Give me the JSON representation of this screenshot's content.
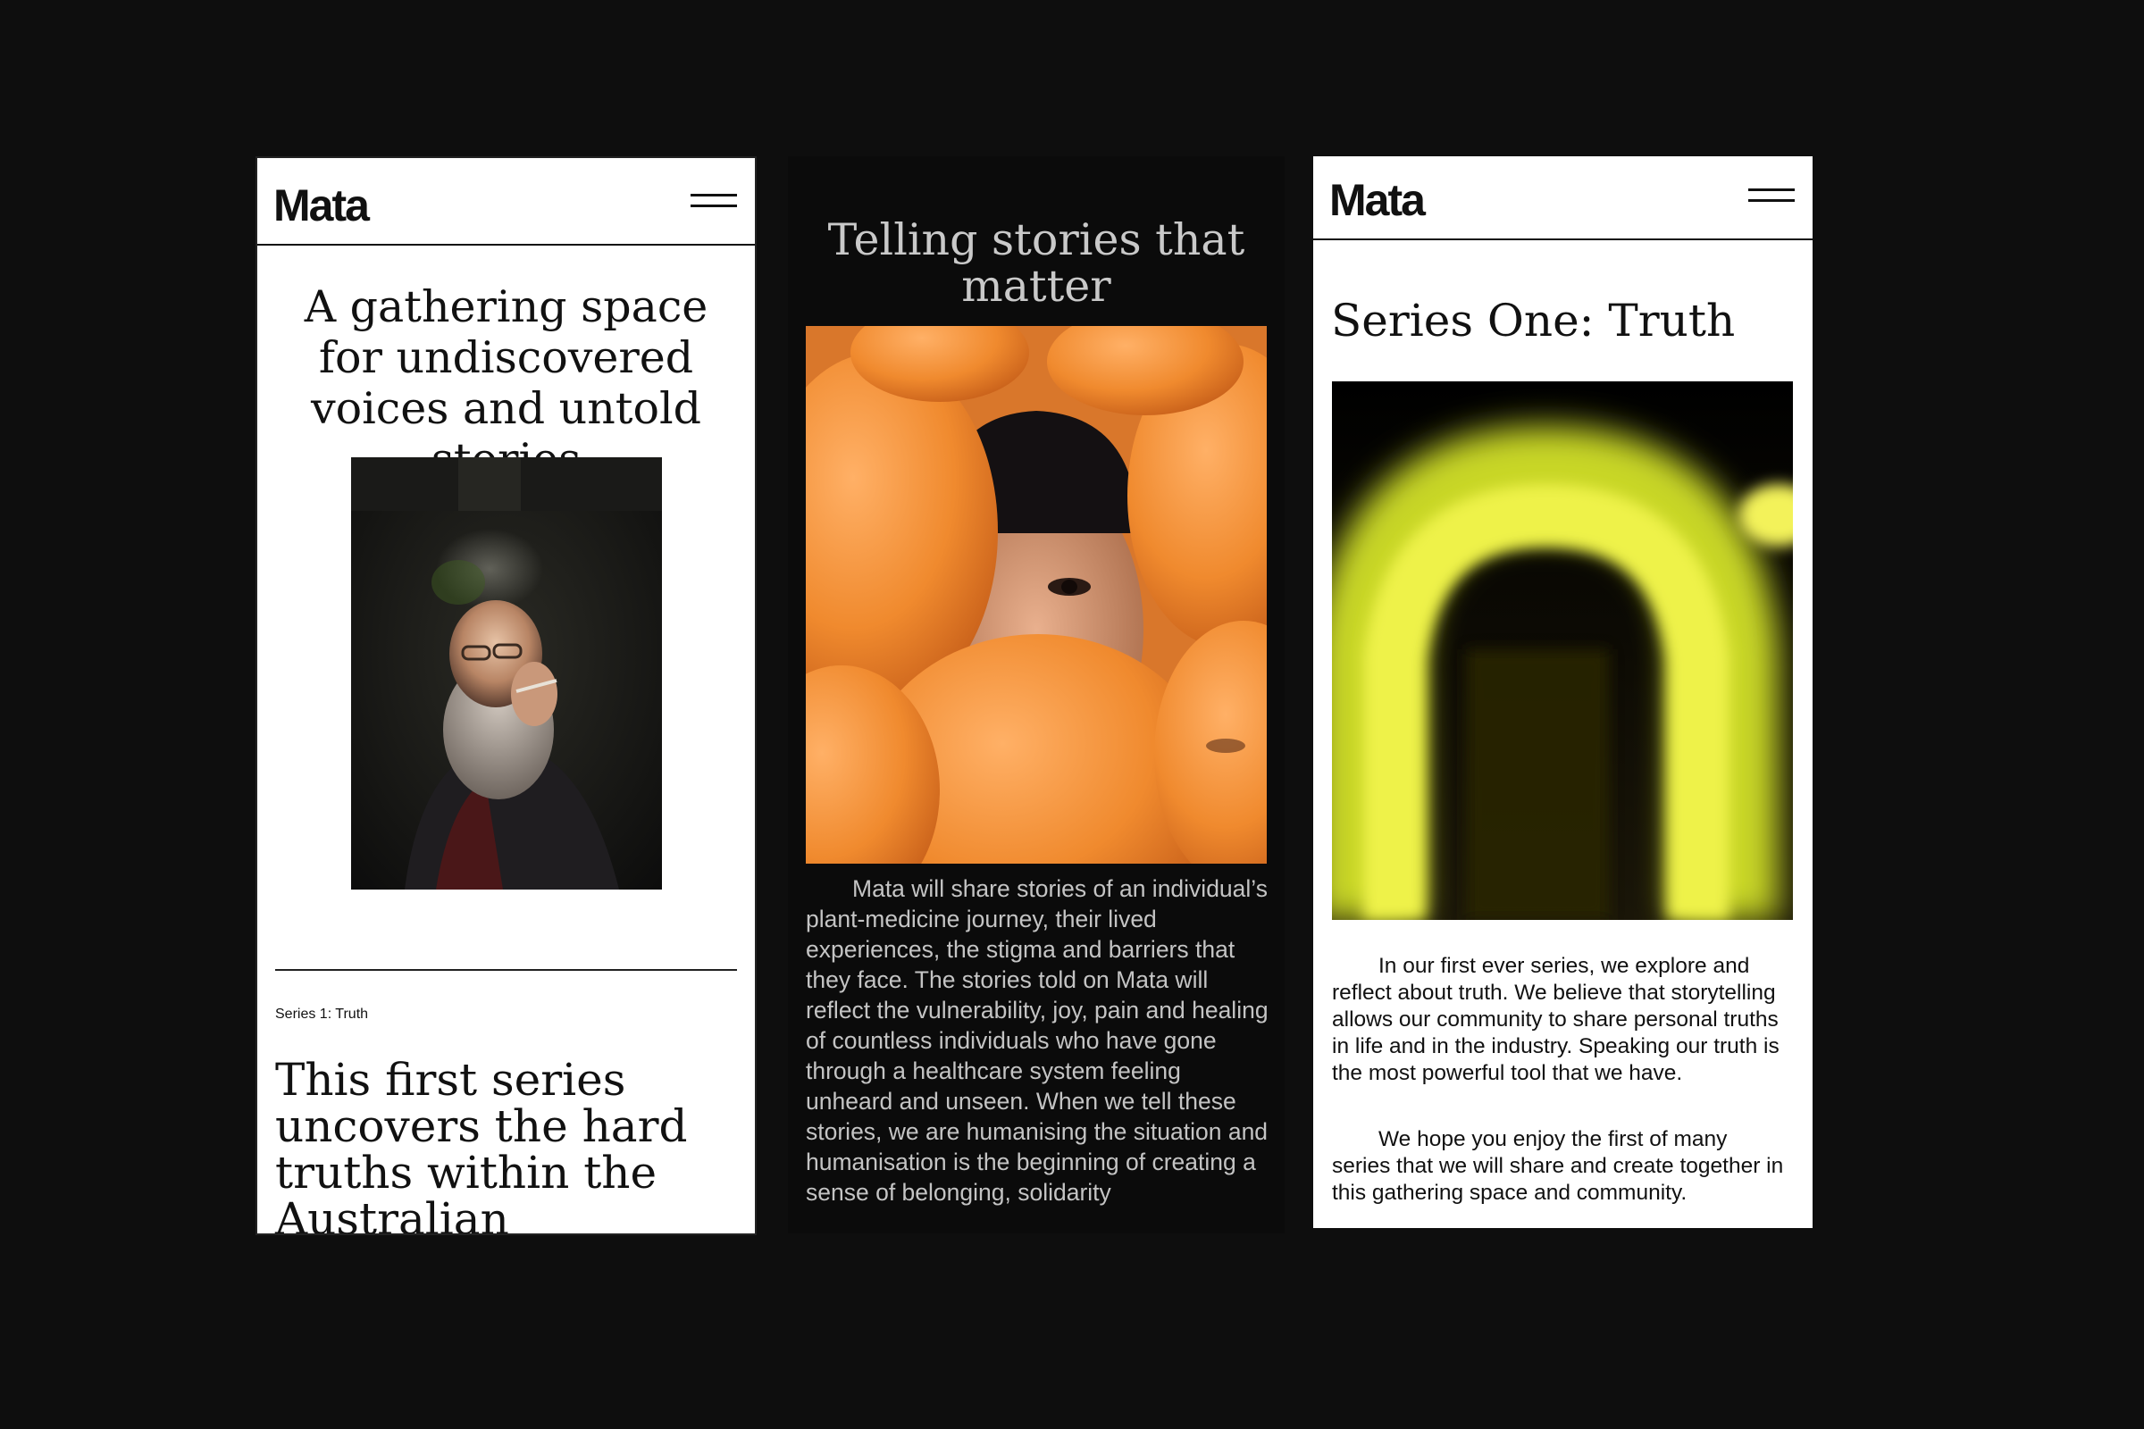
{
  "screens": [
    {
      "logo": "Mata",
      "hero_title": "A gathering space for undiscovered voices and untold stories",
      "series_label": "Series 1: Truth",
      "series_title": "This first series uncovers the hard truths within the Australian medicinal"
    },
    {
      "tagline": "Telling stories that matter",
      "body": "Mata will share stories of an individual’s plant-medicine journey, their lived experiences, the stigma and barriers that they face. The stories told on Mata will reflect the vulnerability, joy, pain and healing of countless individuals who have gone through a healthcare system feeling unheard and unseen. When we tell these stories, we are humanising the situation and humanisation is the beginning of creating a sense of belonging, solidarity"
    },
    {
      "logo": "Mata",
      "page_title": "Series One: Truth",
      "paragraphs": [
        "In our first ever series, we explore and reflect about truth. We believe that storytelling allows our community to share personal truths in life and in the industry. Speaking our truth is the most powerful tool that we have.",
        "We hope you enjoy the first of many series that we will share and create together in this gathering space and community."
      ]
    }
  ],
  "icons": {
    "menu": "hamburger-menu-icon"
  },
  "colors": {
    "backdrop": "#0e0e0e",
    "page_light": "#ffffff",
    "page_dark": "#0b0b0b",
    "orange": "#f08a2e",
    "neon_yellow": "#e8f23a"
  }
}
